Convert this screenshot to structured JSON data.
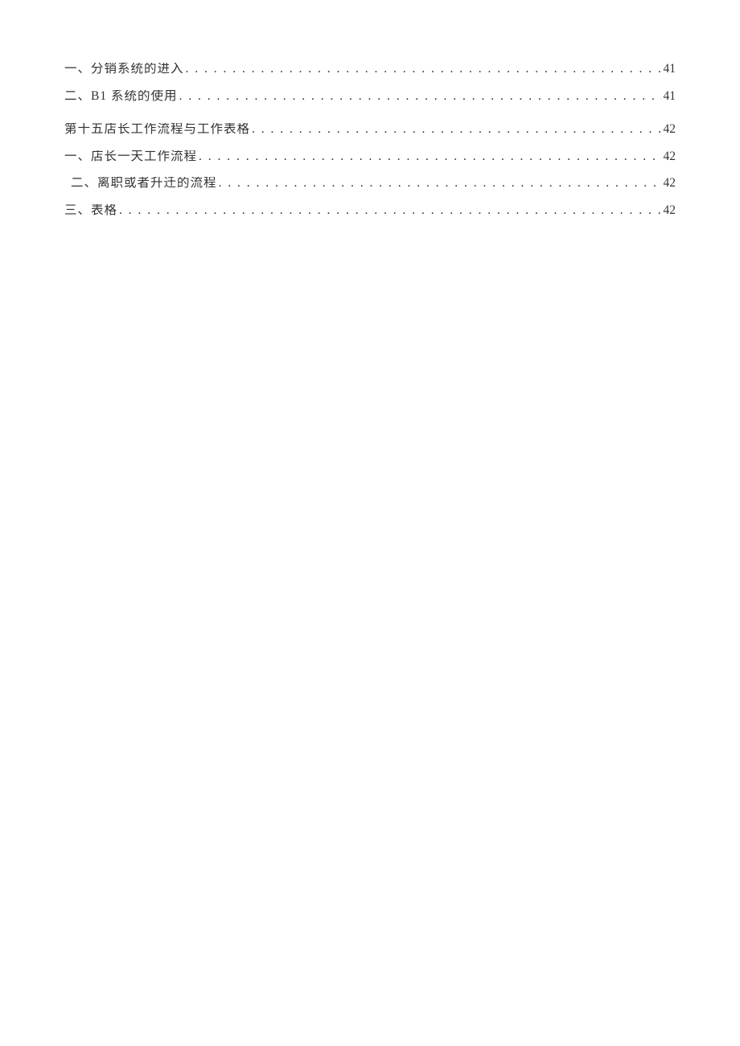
{
  "toc": {
    "block1": [
      {
        "label": "一、分销系统的进入",
        "page": "41",
        "indent": false
      },
      {
        "label": "二、B1 系统的使用",
        "page": "41",
        "indent": false
      }
    ],
    "block2": [
      {
        "label": "第十五店长工作流程与工作表格",
        "page": "42",
        "indent": false
      },
      {
        "label": "一、店长一天工作流程",
        "page": "42",
        "indent": false
      },
      {
        "label": "二、离职或者升迁的流程",
        "page": "42",
        "indent": true
      },
      {
        "label": "三、表格",
        "page": "42",
        "indent": false
      }
    ]
  }
}
